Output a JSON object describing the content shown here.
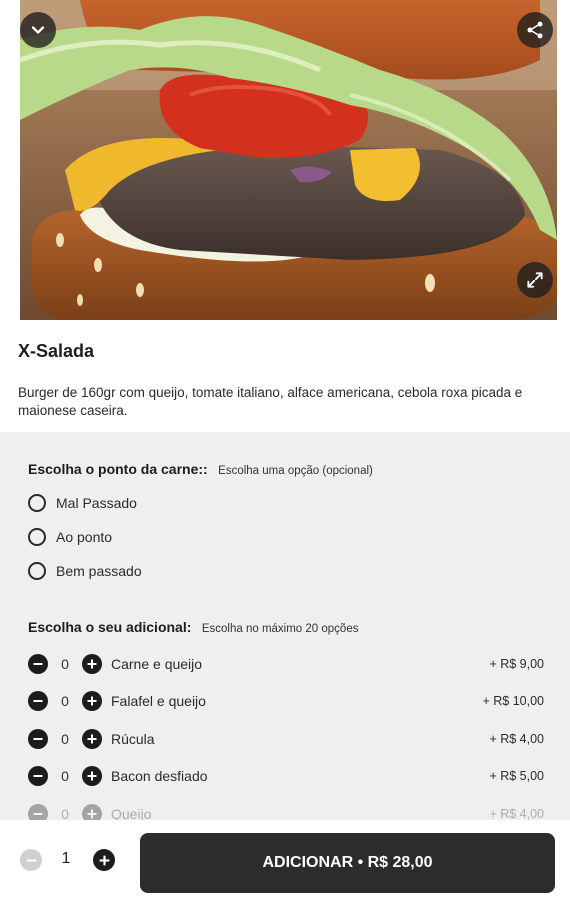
{
  "product": {
    "title": "X-Salada",
    "description": "Burger de 160gr com queijo, tomate italiano, alface americana, cebola roxa picada e maionese caseira.",
    "image_icons": [
      "chevron-down-icon",
      "share-icon",
      "expand-icon"
    ]
  },
  "meat_point": {
    "title": "Escolha o ponto da carne::",
    "subtitle": "Escolha uma opção (opcional)",
    "options": [
      "Mal Passado",
      "Ao ponto",
      "Bem passado"
    ]
  },
  "addons": {
    "title": "Escolha o seu adicional:",
    "subtitle": "Escolha no máximo 20 opções",
    "items": [
      {
        "name": "Carne e queijo",
        "qty": "0",
        "price": "+ R$ 9,00"
      },
      {
        "name": "Falafel e queijo",
        "qty": "0",
        "price": "+ R$ 10,00"
      },
      {
        "name": "Rúcula",
        "qty": "0",
        "price": "+ R$ 4,00"
      },
      {
        "name": "Bacon desfiado",
        "qty": "0",
        "price": "+ R$ 5,00"
      },
      {
        "name": "Queijo",
        "qty": "0",
        "price": "+ R$ 4,00"
      }
    ]
  },
  "footer": {
    "quantity": "1",
    "add_label": "ADICIONAR • R$ 28,00"
  },
  "colors": {
    "dark": "#2c2c2c",
    "panel_bg": "#efefef",
    "disabled": "#cfcfcf"
  }
}
